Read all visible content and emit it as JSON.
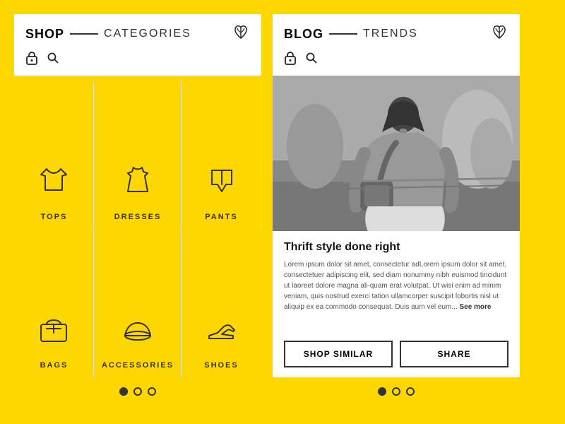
{
  "background_color": "#FFD700",
  "left_panel": {
    "header": {
      "title_bold": "SHOP",
      "title_divider": "—",
      "title_light": "CATEGORIES",
      "logo_symbol": "🌸",
      "icons": [
        "lock",
        "search"
      ]
    },
    "categories": [
      {
        "id": "tops",
        "label": "TOPS"
      },
      {
        "id": "dresses",
        "label": "DRESSES"
      },
      {
        "id": "pants",
        "label": "PANTS"
      },
      {
        "id": "bags",
        "label": "BAGS"
      },
      {
        "id": "accessories",
        "label": "ACCESSORIES"
      },
      {
        "id": "shoes",
        "label": "SHOES"
      }
    ],
    "dots": [
      {
        "active": true
      },
      {
        "active": false
      },
      {
        "active": false
      }
    ]
  },
  "right_panel": {
    "header": {
      "title_bold": "BLOG",
      "title_divider": "—",
      "title_light": "TRENDS",
      "logo_symbol": "🌸",
      "icons": [
        "lock",
        "search"
      ]
    },
    "blog": {
      "title": "Thrift style done right",
      "body": "Lorem ipsum dolor sit amet, consectetur adLorem ipsum dolor sit amet, consectetuer adipiscing elit, sed diam nonummy nibh euismod tincidunt ut laoreet dolore magna ali-quam erat volutpat. Ut wisi enim ad minim veniam, quis nostrud exerci tation ullamcorper suscipit lobortis nisl ut aliquip ex ea commodo consequat. Duis aum vel eum...",
      "see_more": "See more",
      "btn_shop": "SHOP SIMILAR",
      "btn_share": "SHARE"
    },
    "dots": [
      {
        "active": true
      },
      {
        "active": false
      },
      {
        "active": false
      }
    ]
  }
}
